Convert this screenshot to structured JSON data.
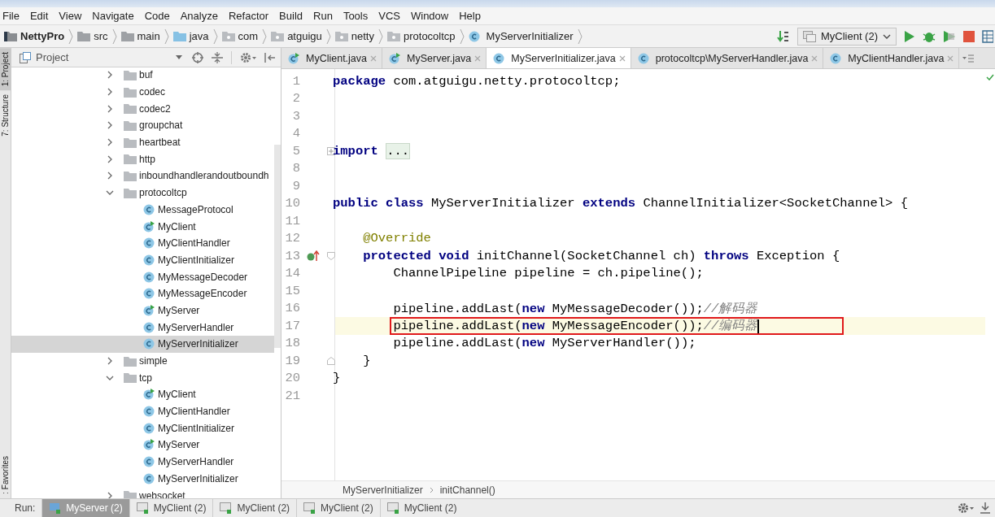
{
  "menu": [
    "File",
    "Edit",
    "View",
    "Navigate",
    "Code",
    "Analyze",
    "Refactor",
    "Build",
    "Run",
    "Tools",
    "VCS",
    "Window",
    "Help"
  ],
  "breadcrumb": [
    {
      "label": "NettyPro",
      "kind": "project"
    },
    {
      "label": "src",
      "kind": "folder"
    },
    {
      "label": "main",
      "kind": "folder"
    },
    {
      "label": "java",
      "kind": "source"
    },
    {
      "label": "com",
      "kind": "package"
    },
    {
      "label": "atguigu",
      "kind": "package"
    },
    {
      "label": "netty",
      "kind": "package"
    },
    {
      "label": "protocoltcp",
      "kind": "package"
    },
    {
      "label": "MyServerInitializer",
      "kind": "class"
    }
  ],
  "run_config": {
    "label": "MyClient (2)"
  },
  "side_tabs": [
    {
      "label": "1: Project",
      "selected": true
    },
    {
      "label": "7: Structure",
      "selected": false
    },
    {
      "label": ": Favorites",
      "selected": false
    }
  ],
  "project_panel": {
    "title": "Project",
    "tree": [
      {
        "label": "buf",
        "kind": "folder",
        "expanded": false,
        "selected": false
      },
      {
        "label": "codec",
        "kind": "folder",
        "expanded": false,
        "selected": false
      },
      {
        "label": "codec2",
        "kind": "folder",
        "expanded": false,
        "selected": false
      },
      {
        "label": "groupchat",
        "kind": "folder",
        "expanded": false,
        "selected": false
      },
      {
        "label": "heartbeat",
        "kind": "folder",
        "expanded": false,
        "selected": false
      },
      {
        "label": "http",
        "kind": "folder",
        "expanded": false,
        "selected": false
      },
      {
        "label": "inboundhandlerandoutboundh",
        "kind": "folder",
        "expanded": false,
        "selected": false
      },
      {
        "label": "protocoltcp",
        "kind": "folder",
        "expanded": true,
        "selected": false,
        "children": [
          {
            "label": "MessageProtocol",
            "kind": "class",
            "selected": false
          },
          {
            "label": "MyClient",
            "kind": "runnable",
            "selected": false
          },
          {
            "label": "MyClientHandler",
            "kind": "class",
            "selected": false
          },
          {
            "label": "MyClientInitializer",
            "kind": "class",
            "selected": false
          },
          {
            "label": "MyMessageDecoder",
            "kind": "class",
            "selected": false
          },
          {
            "label": "MyMessageEncoder",
            "kind": "class",
            "selected": false
          },
          {
            "label": "MyServer",
            "kind": "runnable",
            "selected": false
          },
          {
            "label": "MyServerHandler",
            "kind": "class",
            "selected": false
          },
          {
            "label": "MyServerInitializer",
            "kind": "class",
            "selected": true
          }
        ]
      },
      {
        "label": "simple",
        "kind": "folder",
        "expanded": false,
        "selected": false
      },
      {
        "label": "tcp",
        "kind": "folder",
        "expanded": true,
        "selected": false,
        "children": [
          {
            "label": "MyClient",
            "kind": "runnable",
            "selected": false
          },
          {
            "label": "MyClientHandler",
            "kind": "class",
            "selected": false
          },
          {
            "label": "MyClientInitializer",
            "kind": "class",
            "selected": false
          },
          {
            "label": "MyServer",
            "kind": "runnable",
            "selected": false
          },
          {
            "label": "MyServerHandler",
            "kind": "class",
            "selected": false
          },
          {
            "label": "MyServerInitializer",
            "kind": "class",
            "selected": false
          }
        ]
      },
      {
        "label": "websocket",
        "kind": "folder",
        "expanded": false,
        "selected": false
      }
    ]
  },
  "editor_tabs": [
    {
      "label": "MyClient.java",
      "kind": "runnable",
      "selected": false
    },
    {
      "label": "MyServer.java",
      "kind": "runnable",
      "selected": false
    },
    {
      "label": "MyServerInitializer.java",
      "kind": "class",
      "selected": true
    },
    {
      "label": "protocoltcp\\MyServerHandler.java",
      "kind": "class",
      "selected": false
    },
    {
      "label": "MyClientHandler.java",
      "kind": "class",
      "selected": false
    }
  ],
  "code": [
    {
      "number": "1",
      "tokens": [
        {
          "kind": "keyword",
          "text": "package"
        },
        {
          "kind": "plain",
          "text": " com.atguigu.netty.protocoltcp;"
        }
      ]
    },
    {
      "number": "2"
    },
    {
      "number": "3"
    },
    {
      "number": "4"
    },
    {
      "number": "5",
      "fold": {
        "kind": "expand"
      },
      "tokens": [
        {
          "kind": "keyword",
          "text": "import "
        },
        {
          "kind": "folded",
          "text": "..."
        }
      ]
    },
    {
      "number": "8"
    },
    {
      "number": "9"
    },
    {
      "number": "10",
      "tokens": [
        {
          "kind": "keyword",
          "text": "public class"
        },
        {
          "kind": "plain",
          "text": " MyServerInitializer "
        },
        {
          "kind": "keyword",
          "text": "extends"
        },
        {
          "kind": "plain",
          "text": " ChannelInitializer<SocketChannel> {"
        }
      ]
    },
    {
      "number": "11"
    },
    {
      "number": "12",
      "tokens": [
        {
          "kind": "annotation",
          "text": "    @Override"
        }
      ]
    },
    {
      "number": "13",
      "gutter_icon": {
        "kind": "override"
      },
      "fold": {
        "kind": "start"
      },
      "tokens": [
        {
          "kind": "keyword",
          "text": "    protected void"
        },
        {
          "kind": "plain",
          "text": " initChannel(SocketChannel ch) "
        },
        {
          "kind": "keyword",
          "text": "throws"
        },
        {
          "kind": "plain",
          "text": " Exception {"
        }
      ]
    },
    {
      "number": "14",
      "tokens": [
        {
          "kind": "plain",
          "text": "        ChannelPipeline pipeline = ch.pipeline();"
        }
      ]
    },
    {
      "number": "15"
    },
    {
      "number": "16",
      "tokens": [
        {
          "kind": "plain",
          "text": "        pipeline.addLast("
        },
        {
          "kind": "keyword",
          "text": "new"
        },
        {
          "kind": "plain",
          "text": " MyMessageDecoder());"
        },
        {
          "kind": "comment",
          "text": "//解码器"
        }
      ]
    },
    {
      "number": "17",
      "current": true,
      "boxed": true,
      "tokens": [
        {
          "kind": "plain",
          "text": "        pipeline.addLast("
        },
        {
          "kind": "keyword",
          "text": "new"
        },
        {
          "kind": "plain",
          "text": " MyMessageEncoder());"
        },
        {
          "kind": "comment",
          "text": "//编码器"
        }
      ]
    },
    {
      "number": "18",
      "tokens": [
        {
          "kind": "plain",
          "text": "        pipeline.addLast("
        },
        {
          "kind": "keyword",
          "text": "new"
        },
        {
          "kind": "plain",
          "text": " MyServerHandler());"
        }
      ]
    },
    {
      "number": "19",
      "fold": {
        "kind": "end"
      },
      "tokens": [
        {
          "kind": "plain",
          "text": "    }"
        }
      ]
    },
    {
      "number": "20",
      "tokens": [
        {
          "kind": "plain",
          "text": "}"
        }
      ]
    },
    {
      "number": "21"
    }
  ],
  "editor_breadcrumb": [
    "MyServerInitializer",
    "initChannel()"
  ],
  "run_bar": {
    "label": "Run:",
    "tabs": [
      {
        "label": "MyServer (2)",
        "selected": true
      },
      {
        "label": "MyClient (2)",
        "selected": false
      },
      {
        "label": "MyClient (2)",
        "selected": false
      },
      {
        "label": "MyClient (2)",
        "selected": false
      },
      {
        "label": "MyClient (2)",
        "selected": false
      }
    ]
  }
}
